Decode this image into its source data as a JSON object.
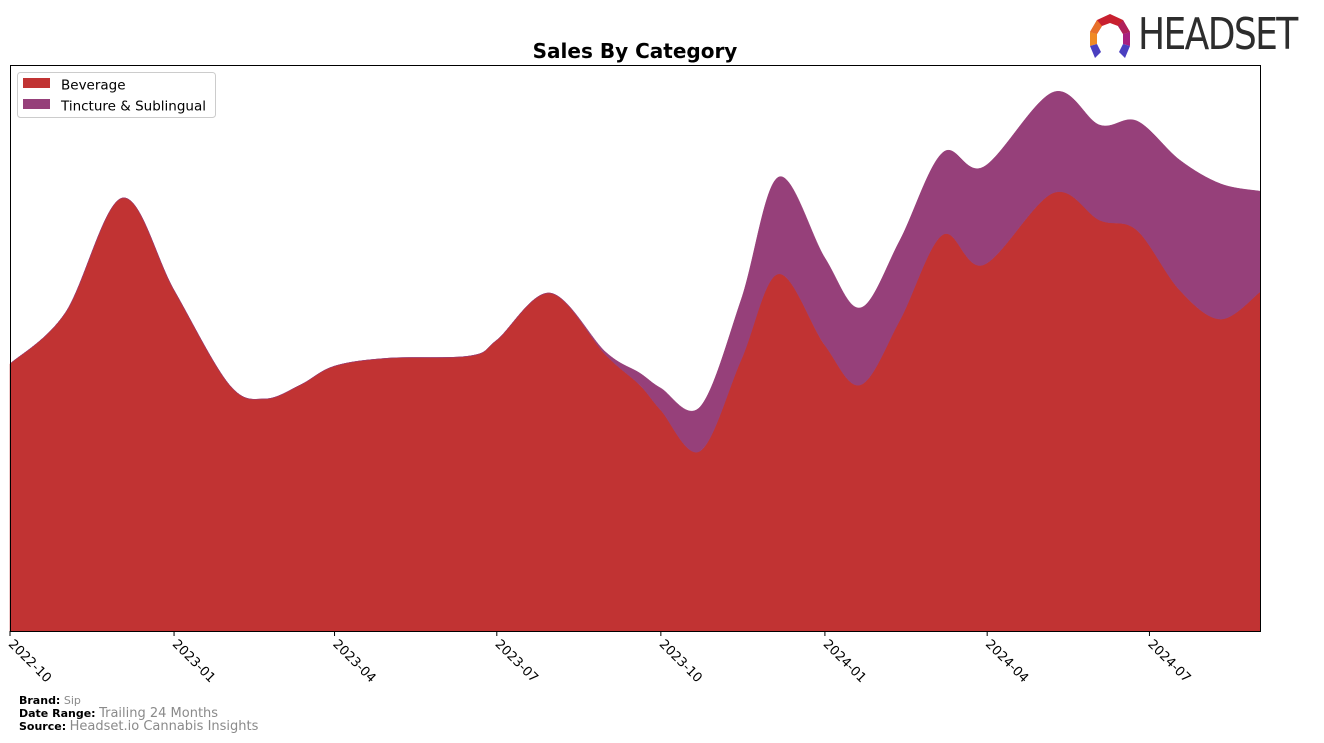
{
  "brand_logo": {
    "text": "HEADSET",
    "icon": "headset-logo-icon"
  },
  "footer": {
    "brand_label": "Brand:",
    "brand_value": "Sip",
    "date_range_label": "Date Range:",
    "date_range_value": "Trailing 24 Months",
    "source_label": "Source:",
    "source_value": "Headset.io Cannabis Insights"
  },
  "chart_data": {
    "type": "area",
    "stacked": true,
    "smoothed": true,
    "title": "Sales By Category",
    "xlabel": "",
    "ylabel": "",
    "y_ticks_visible": false,
    "units": "relative sales (arbitrary units, no axis shown)",
    "xlim": [
      "2022-10-01",
      "2024-09-01"
    ],
    "ylim": [
      0,
      100
    ],
    "grid": false,
    "legend_position": "top-left",
    "x_ticks": [
      "2022-10",
      "2023-01",
      "2023-04",
      "2023-07",
      "2023-10",
      "2024-01",
      "2024-04",
      "2024-07"
    ],
    "x_tick_dates": [
      "2022-10-01",
      "2023-01-01",
      "2023-04-01",
      "2023-07-01",
      "2023-10-01",
      "2024-01-01",
      "2024-04-01",
      "2024-07-01"
    ],
    "x": [
      "2022-10-01",
      "2022-11-01",
      "2022-12-03",
      "2023-01-01",
      "2023-02-01",
      "2023-02-21",
      "2023-03-13",
      "2023-04-01",
      "2023-05-01",
      "2023-06-16",
      "2023-07-01",
      "2023-07-31",
      "2023-08-31",
      "2023-09-19",
      "2023-10-01",
      "2023-10-23",
      "2023-11-15",
      "2023-12-06",
      "2024-01-01",
      "2024-01-21",
      "2024-02-12",
      "2024-03-07",
      "2024-03-30",
      "2024-05-08",
      "2024-06-03",
      "2024-06-24",
      "2024-07-18",
      "2024-08-10",
      "2024-09-01"
    ],
    "series": [
      {
        "name": "Beverage",
        "color": "#c13333",
        "values": [
          47.2,
          56.2,
          76.5,
          60.2,
          43.5,
          41.0,
          43.5,
          46.8,
          48.2,
          48.6,
          51.4,
          59.7,
          48.8,
          43.5,
          39.0,
          31.8,
          47.9,
          63.1,
          50.5,
          43.5,
          54.9,
          70.0,
          64.7,
          77.4,
          72.6,
          70.8,
          60.2,
          55.1,
          59.9
        ]
      },
      {
        "name": "Tincture & Sublingual",
        "color": "#96407a",
        "values": [
          0,
          0,
          0,
          0,
          0,
          0,
          0,
          0,
          0,
          0,
          0,
          0,
          0.5,
          2.1,
          3.9,
          7.8,
          10.6,
          17.1,
          15.4,
          13.6,
          14.1,
          14.5,
          17.3,
          17.8,
          16.8,
          19.3,
          23.0,
          23.9,
          17.8
        ]
      }
    ]
  }
}
